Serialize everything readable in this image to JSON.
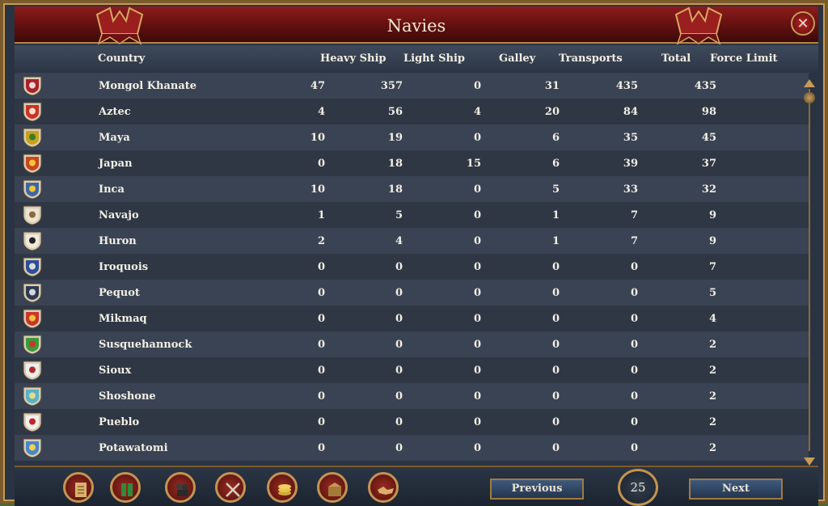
{
  "window": {
    "title": "Navies",
    "close_label": "✕"
  },
  "columns": [
    "Country",
    "Heavy Ship",
    "Light Ship",
    "Galley",
    "Transports",
    "Total",
    "Force Limit"
  ],
  "rows": [
    {
      "country": "Mongol Khanate",
      "heavy": "47",
      "light": "357",
      "galley": "0",
      "transports": "31",
      "total": "435",
      "force_limit": "435",
      "color": "#a7222b",
      "mark": "#f2d5d5"
    },
    {
      "country": "Aztec",
      "heavy": "4",
      "light": "56",
      "galley": "4",
      "transports": "20",
      "total": "84",
      "force_limit": "98",
      "color": "#c7322a",
      "mark": "#f7e0c0"
    },
    {
      "country": "Maya",
      "heavy": "10",
      "light": "19",
      "galley": "0",
      "transports": "6",
      "total": "35",
      "force_limit": "45",
      "color": "#c8a21f",
      "mark": "#3c7a2a"
    },
    {
      "country": "Japan",
      "heavy": "0",
      "light": "18",
      "galley": "15",
      "transports": "6",
      "total": "39",
      "force_limit": "37",
      "color": "#c8461e",
      "mark": "#f3c53b"
    },
    {
      "country": "Inca",
      "heavy": "10",
      "light": "18",
      "galley": "0",
      "transports": "5",
      "total": "33",
      "force_limit": "32",
      "color": "#3e66a6",
      "mark": "#f1c736"
    },
    {
      "country": "Navajo",
      "heavy": "1",
      "light": "5",
      "galley": "0",
      "transports": "1",
      "total": "7",
      "force_limit": "9",
      "color": "#e9e4d4",
      "mark": "#8d6a3c"
    },
    {
      "country": "Huron",
      "heavy": "2",
      "light": "4",
      "galley": "0",
      "transports": "1",
      "total": "7",
      "force_limit": "9",
      "color": "#efeadd",
      "mark": "#222222"
    },
    {
      "country": "Iroquois",
      "heavy": "0",
      "light": "0",
      "galley": "0",
      "transports": "0",
      "total": "0",
      "force_limit": "7",
      "color": "#2c4f98",
      "mark": "#dcdcdc"
    },
    {
      "country": "Pequot",
      "heavy": "0",
      "light": "0",
      "galley": "0",
      "transports": "0",
      "total": "0",
      "force_limit": "5",
      "color": "#2d3a52",
      "mark": "#d8d8d8"
    },
    {
      "country": "Mikmaq",
      "heavy": "0",
      "light": "0",
      "galley": "0",
      "transports": "0",
      "total": "0",
      "force_limit": "4",
      "color": "#c9362a",
      "mark": "#f2c33c"
    },
    {
      "country": "Susquehannock",
      "heavy": "0",
      "light": "0",
      "galley": "0",
      "transports": "0",
      "total": "0",
      "force_limit": "2",
      "color": "#3a9a3a",
      "mark": "#c8352d"
    },
    {
      "country": "Sioux",
      "heavy": "0",
      "light": "0",
      "galley": "0",
      "transports": "0",
      "total": "0",
      "force_limit": "2",
      "color": "#eeeeee",
      "mark": "#b12a2a"
    },
    {
      "country": "Shoshone",
      "heavy": "0",
      "light": "0",
      "galley": "0",
      "transports": "0",
      "total": "0",
      "force_limit": "2",
      "color": "#58b3c6",
      "mark": "#e9d88a"
    },
    {
      "country": "Pueblo",
      "heavy": "0",
      "light": "0",
      "galley": "0",
      "transports": "0",
      "total": "0",
      "force_limit": "2",
      "color": "#f4f0ea",
      "mark": "#c0262a"
    },
    {
      "country": "Potawatomi",
      "heavy": "0",
      "light": "0",
      "galley": "0",
      "transports": "0",
      "total": "0",
      "force_limit": "2",
      "color": "#4a86c8",
      "mark": "#f0d24c"
    }
  ],
  "footer": {
    "previous_label": "Previous",
    "next_label": "Next",
    "page": "25",
    "tools": [
      "ledger-icon",
      "flags-icon",
      "army-icon",
      "crossed-swords-icon",
      "coins-icon",
      "trade-goods-icon",
      "handshake-icon"
    ]
  },
  "colors": {
    "accent_red": "#8e1b1b",
    "gold_trim": "#c79b55",
    "row_light": "#3a4353",
    "row_dark": "#2f3745"
  }
}
